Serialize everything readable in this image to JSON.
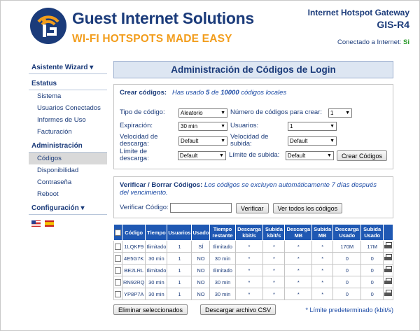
{
  "brand": {
    "title": "Guest Internet Solutions",
    "tagline": "WI-FI HOTSPOTS MADE EASY"
  },
  "header": {
    "gateway": "Internet Hotspot Gateway",
    "model": "GIS-R4",
    "connected_label": "Conectado a Internet:",
    "connected_value": "Si"
  },
  "sidebar": {
    "wizard": "Asistente Wizard ▾",
    "status_head": "Estatus",
    "status_items": [
      "Sistema",
      "Usuarios Conectados",
      "Informes de Uso",
      "Facturación"
    ],
    "admin_head": "Administración",
    "admin_items": [
      "Códigos",
      "Disponibilidad",
      "Contraseña",
      "Reboot"
    ],
    "config": "Configuración ▾"
  },
  "main": {
    "title": "Administración de Códigos de Login",
    "create": {
      "head": "Crear códigos:",
      "note": "Has usado 5 de 10000 códigos locales",
      "note_pre": "Has usado ",
      "used": "5",
      "note_mid": " de ",
      "total": "10000",
      "note_post": " códigos locales",
      "tipo_label": "Tipo de código:",
      "tipo_value": "Aleatorio",
      "numero_label": "Número de códigos para crear:",
      "numero_value": "1",
      "exp_label": "Expiración:",
      "exp_value": "30 min",
      "usuarios_label": "Usuarios:",
      "usuarios_value": "1",
      "vdesc_label": "Velocidad de descarga:",
      "vdesc_value": "Default",
      "vsub_label": "Velocidad de subida:",
      "vsub_value": "Default",
      "ldesc_label": "Límite de descarga:",
      "ldesc_value": "Default",
      "lsub_label": "Límite de subida:",
      "lsub_value": "Default",
      "button": "Crear Códigos"
    },
    "verify": {
      "head": "Verificar / Borrar Códigos:",
      "note": "Los códigos se excluyen automáticamente 7 días después del vencimiento.",
      "label": "Verificar Código:",
      "verify_button": "Verificar",
      "all_button": "Ver todos los códigos"
    },
    "table": {
      "headers": [
        "Código",
        "Tiempo",
        "Usuarios",
        "Usado",
        "Tiempo restante",
        "Descarga kbit/s",
        "Subida kbit/s",
        "Descarga MB",
        "Subida MB",
        "Descarga Usado",
        "Subida Usado"
      ],
      "rows": [
        [
          "1LQKF9",
          "Ilimitado",
          "1",
          "SÍ",
          "Ilimitado",
          "*",
          "*",
          "*",
          "*",
          "170M",
          "17M"
        ],
        [
          "4E5G7K",
          "30 min",
          "1",
          "NO",
          "30 min",
          "*",
          "*",
          "*",
          "*",
          "0",
          "0"
        ],
        [
          "BE2LRL",
          "Ilimitado",
          "1",
          "NO",
          "Ilimitado",
          "*",
          "*",
          "*",
          "*",
          "0",
          "0"
        ],
        [
          "RN92RQ",
          "30 min",
          "1",
          "NO",
          "30 min",
          "*",
          "*",
          "*",
          "*",
          "0",
          "0"
        ],
        [
          "YP8P7A",
          "30 min",
          "1",
          "NO",
          "30 min",
          "*",
          "*",
          "*",
          "*",
          "0",
          "0"
        ]
      ]
    },
    "delete_button": "Eliminar seleccionados",
    "download_button": "Descargar archivo CSV",
    "footnote": "* Límite predeterminado (kbit/s)"
  },
  "colors": {
    "navy": "#1b3b7a",
    "orange": "#f29d1c",
    "table_header": "#1f58b3",
    "yes": "#2a9a2a",
    "no": "#d01010"
  }
}
